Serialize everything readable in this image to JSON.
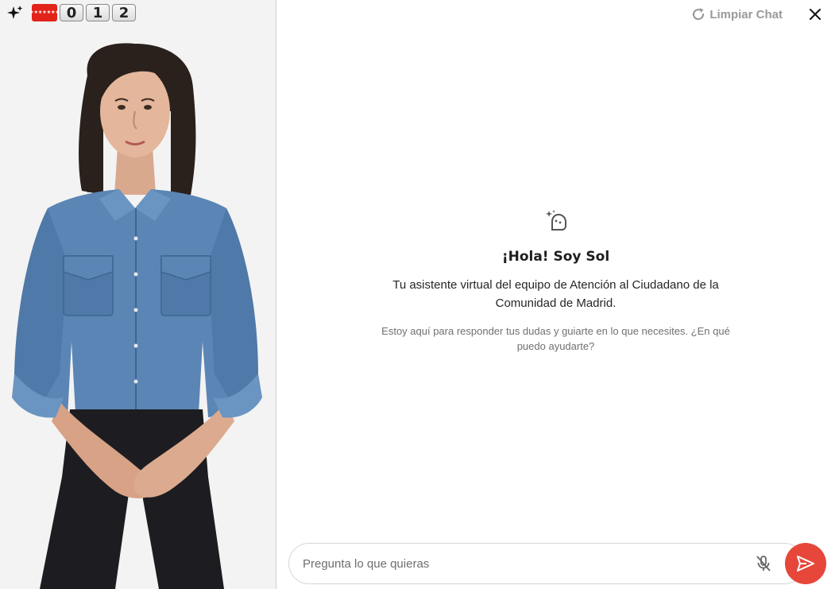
{
  "brand": {
    "sparkle_icon": "sparkle-icon",
    "flag_icon": "madrid-flag-icon",
    "flag_stars": "★★★★★★★",
    "digits": [
      "0",
      "1",
      "2"
    ],
    "flag_color": "#e2231a"
  },
  "header": {
    "clear_chat_label": "Limpiar Chat",
    "clear_chat_icon": "refresh-icon",
    "close_icon": "close-icon"
  },
  "welcome": {
    "icon": "bot-sparkle-icon",
    "title": "¡Hola! Soy Sol",
    "subtitle": "Tu asistente virtual del equipo de Atención al Ciudadano de la Comunidad de Madrid.",
    "text": "Estoy aquí para responder tus dudas y guiarte en lo que necesites. ¿En qué puedo ayudarte?"
  },
  "composer": {
    "placeholder": "Pregunta lo que quieras",
    "value": "",
    "mic_icon": "mic-off-icon",
    "send_icon": "send-icon",
    "send_color": "#e6473a"
  },
  "avatar": {
    "icon": "avatar-woman-denim-shirt"
  }
}
